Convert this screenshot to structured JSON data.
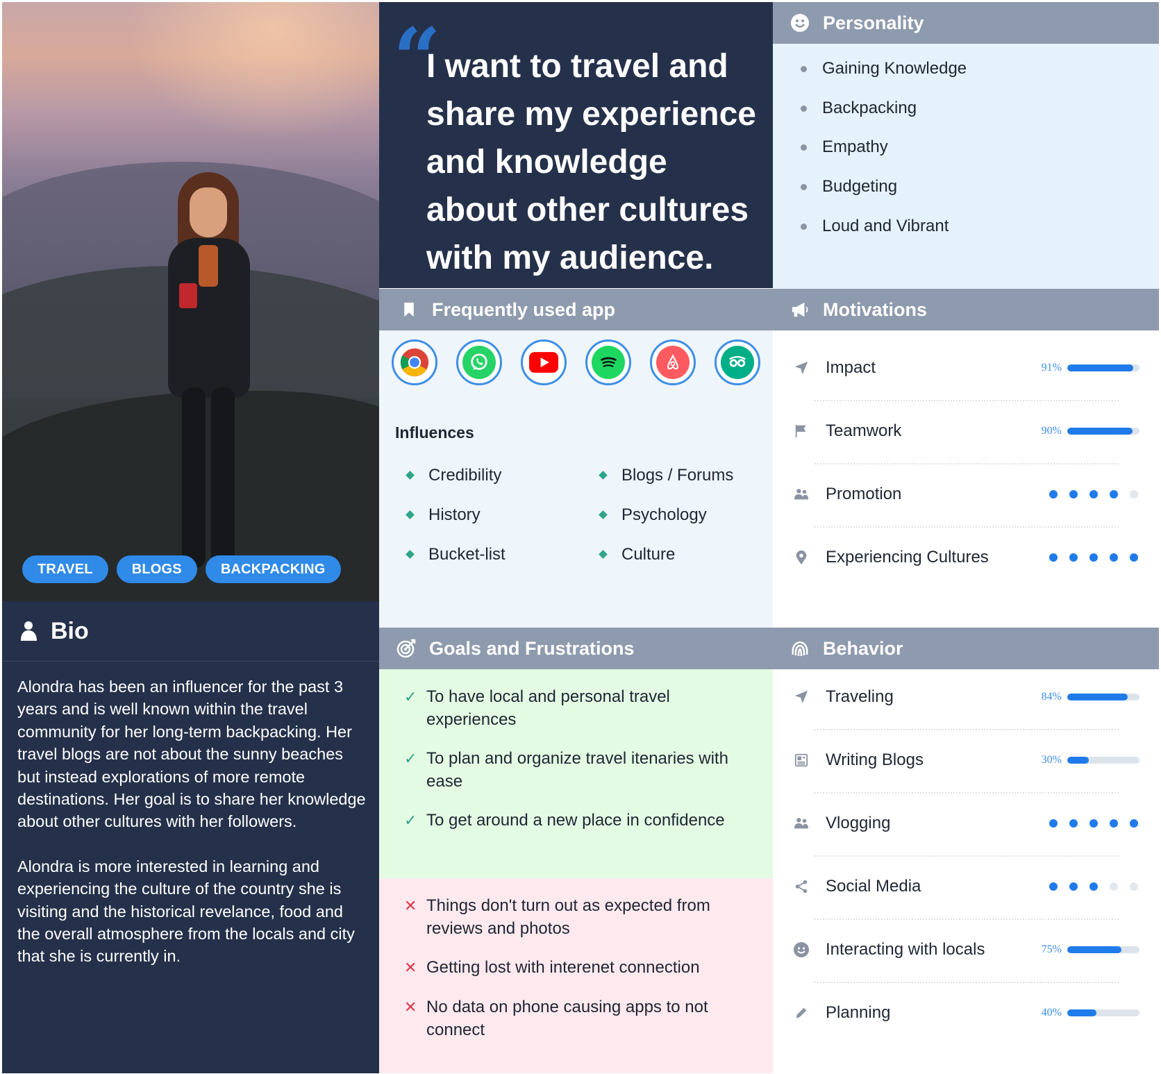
{
  "tags": [
    "TRAVEL",
    "BLOGS",
    "BACKPACKING"
  ],
  "bio": {
    "title": "Bio",
    "paragraphs": [
      "Alondra has been an influencer for the past 3 years and is well known within the travel community for her long-term backpacking. Her travel blogs are not about the sunny beaches but instead explorations of more remote destinations. Her goal is to share her knowledge about other cultures with her followers.",
      "Alondra is more interested in learning and experiencing the culture of the country she is visiting and the historical revelance, food and the overall atmosphere from the locals and city that she is currently in."
    ]
  },
  "quote": "I want to travel and share my experience and knowledge about other cultures with my audience.",
  "personality": {
    "title": "Personality",
    "items": [
      "Gaining Knowledge",
      "Backpacking",
      "Empathy",
      "Budgeting",
      "Loud and Vibrant"
    ]
  },
  "apps": {
    "title": "Frequently used app",
    "icons": [
      "chrome-icon",
      "whatsapp-icon",
      "youtube-icon",
      "spotify-icon",
      "airbnb-icon",
      "tripadvisor-icon"
    ]
  },
  "influences": {
    "title": "Influences",
    "items": [
      "Credibility",
      "Blogs / Forums",
      "History",
      "Psychology",
      "Bucket-list",
      "Culture"
    ]
  },
  "motivations": {
    "title": "Motivations",
    "items": [
      {
        "label": "Impact",
        "kind": "bar",
        "percent_label": "91%",
        "value": 0.91,
        "icon": "paper-plane-icon"
      },
      {
        "label": "Teamwork",
        "kind": "bar",
        "percent_label": "90%",
        "value": 0.9,
        "icon": "flag-icon"
      },
      {
        "label": "Promotion",
        "kind": "dots",
        "filled": 4,
        "total": 5,
        "icon": "people-icon"
      },
      {
        "label": "Experiencing Cultures",
        "kind": "dots",
        "filled": 5,
        "total": 5,
        "icon": "map-pin-icon"
      }
    ]
  },
  "goals": {
    "title": "Goals and Frustrations",
    "goals": [
      "To have local and personal travel experiences",
      "To plan and organize travel itenaries with ease",
      "To get around a new place in confidence"
    ],
    "frustrations": [
      "Things don't turn out as expected from reviews and photos",
      "Getting lost with interenet connection",
      "No data on phone causing apps to not connect"
    ]
  },
  "behavior": {
    "title": "Behavior",
    "items": [
      {
        "label": "Traveling",
        "kind": "bar",
        "percent_label": "84%",
        "value": 0.84,
        "icon": "paper-plane-icon"
      },
      {
        "label": "Writing Blogs",
        "kind": "bar",
        "percent_label": "30%",
        "value": 0.3,
        "icon": "document-icon"
      },
      {
        "label": "Vlogging",
        "kind": "dots",
        "filled": 5,
        "total": 5,
        "icon": "people-icon"
      },
      {
        "label": "Social Media",
        "kind": "dots",
        "filled": 3,
        "total": 5,
        "icon": "share-icon"
      },
      {
        "label": "Interacting with locals",
        "kind": "bar",
        "percent_label": "75%",
        "value": 0.75,
        "icon": "smiley-icon"
      },
      {
        "label": "Planning",
        "kind": "bar",
        "percent_label": "40%",
        "value": 0.4,
        "icon": "pencil-icon"
      }
    ]
  },
  "colors": {
    "navy": "#25314a",
    "header_gray": "#8e9aad",
    "accent_blue": "#1f7bea",
    "goal_green": "#e3fbe3",
    "frustration_pink": "#fde9ee",
    "check_green": "#2ea58a",
    "cross_red": "#e2364e"
  }
}
